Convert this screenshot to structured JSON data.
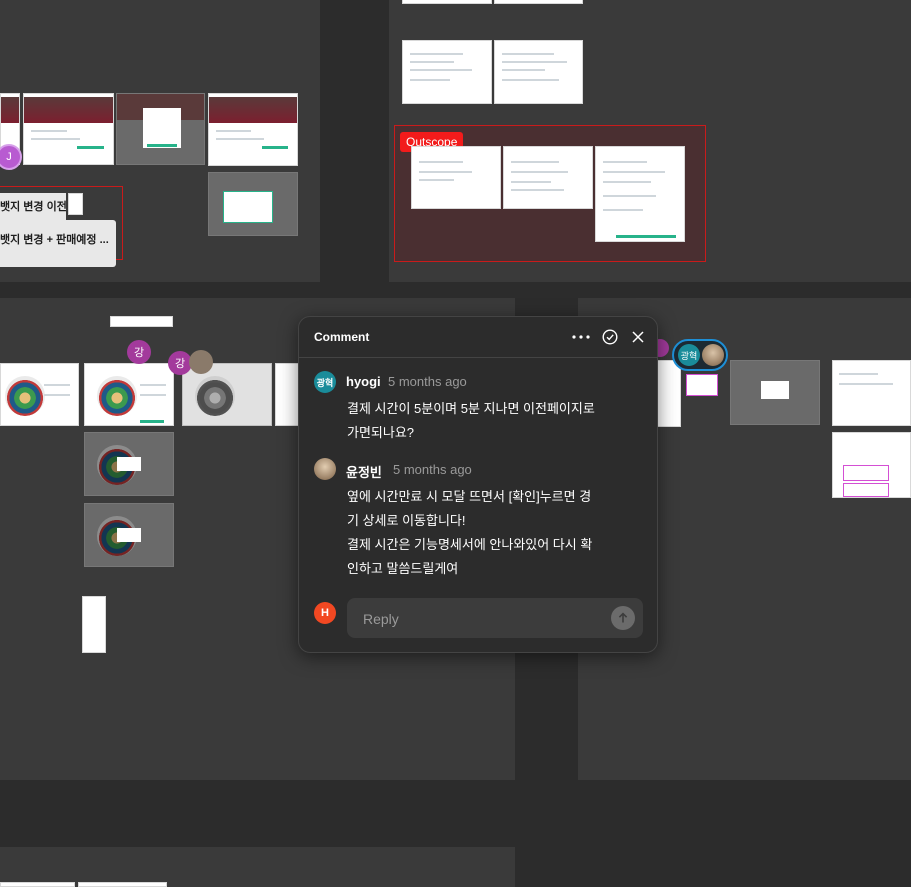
{
  "canvas": {
    "outscope_label": "Outscope",
    "tag_badge_change_before": "뱃지 변경 이전",
    "tag_badge_change_presale": "뱃지 변경 + 판매예정 ...",
    "collaborator_j": "J",
    "collaborator_kang_1": "강",
    "collaborator_kang_2": "강",
    "collaborator_kwanghyuk": "광혁",
    "colors": {
      "background": "#2c2c2c",
      "section": "#3a3a3a",
      "outscope": "#f21b1b"
    }
  },
  "comment_panel": {
    "title": "Comment",
    "comments": [
      {
        "avatar_text": "광혁",
        "author": "hyogi",
        "time": "5 months ago",
        "lines": [
          "결제 시간이 5분이며 5분 지나면 이전페이지로",
          "가면되나요?"
        ]
      },
      {
        "avatar_text": "",
        "author": "윤정빈",
        "time": "5 months ago",
        "lines": [
          "옆에 시간만료 시 모달 뜨면서 [확인]누르면 경",
          "기 상세로 이동합니다!",
          "결제 시간은 기능명세서에 안나와있어 다시 확",
          "인하고 말씀드릴게여"
        ]
      }
    ],
    "reply": {
      "avatar_text": "H",
      "placeholder": "Reply"
    },
    "icons": {
      "more": "more-icon",
      "resolve": "check-circle-icon",
      "close": "close-icon",
      "send": "arrow-up-icon"
    }
  }
}
